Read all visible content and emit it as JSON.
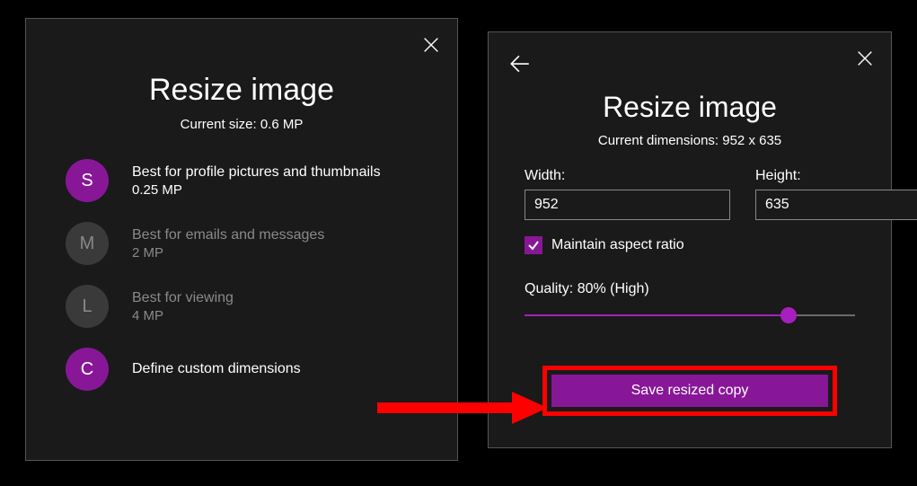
{
  "left": {
    "title": "Resize image",
    "subtitle": "Current size: 0.6 MP",
    "options": [
      {
        "letter": "S",
        "label": "Best for profile pictures and thumbnails",
        "sub": "0.25 MP",
        "active": true
      },
      {
        "letter": "M",
        "label": "Best for emails and messages",
        "sub": "2 MP",
        "active": false
      },
      {
        "letter": "L",
        "label": "Best for viewing",
        "sub": "4 MP",
        "active": false
      },
      {
        "letter": "C",
        "label": "Define custom dimensions",
        "sub": "",
        "active": true
      }
    ]
  },
  "right": {
    "title": "Resize image",
    "subtitle": "Current dimensions: 952 x 635",
    "width_label": "Width:",
    "width_value": "952",
    "height_label": "Height:",
    "height_value": "635",
    "aspect_label": "Maintain aspect ratio",
    "quality_label": "Quality: 80% (High)",
    "save_label": "Save resized copy"
  }
}
